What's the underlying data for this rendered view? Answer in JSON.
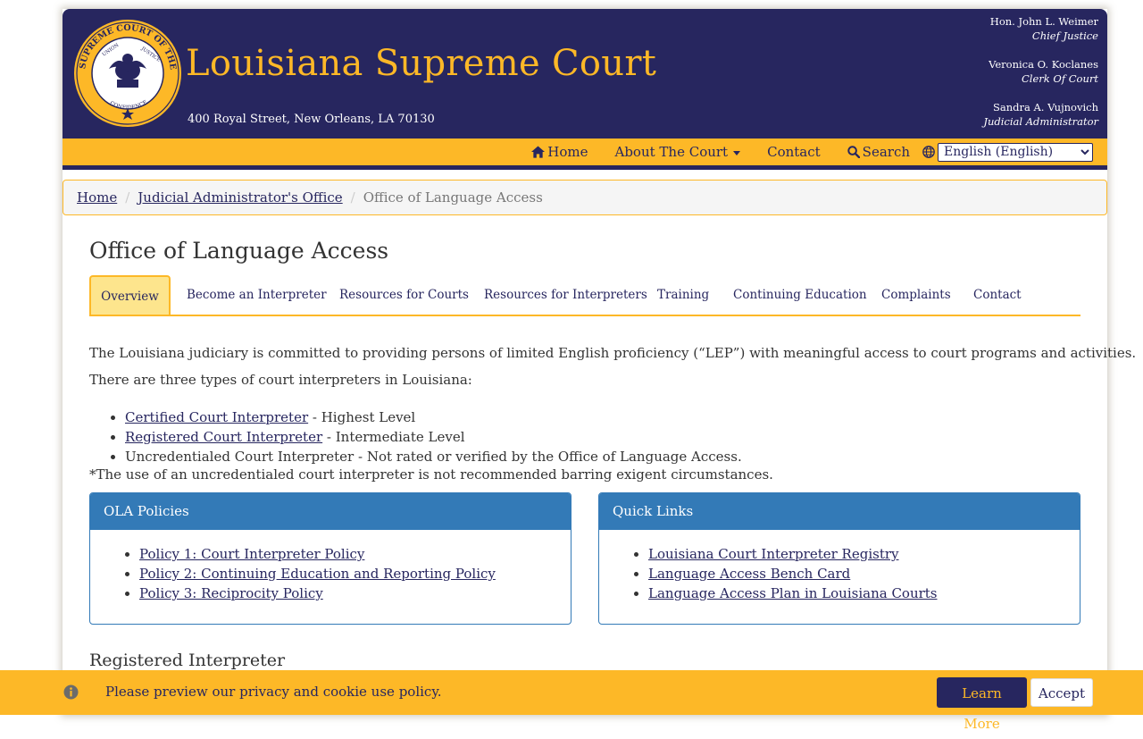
{
  "header": {
    "title": "Louisiana Supreme Court",
    "address": "400 Royal Street, New Orleans, LA 70130",
    "seal": {
      "text_top": "SUPREME COURT OF THE STATE OF LOUISIANA",
      "union": "UNION",
      "justice": "JUSTICE",
      "confidence": "CONFIDENCE"
    },
    "officials": [
      {
        "name": "Hon. John L. Weimer",
        "role": "Chief Justice"
      },
      {
        "name": "Veronica O. Koclanes",
        "role": "Clerk Of Court"
      },
      {
        "name": "Sandra A. Vujnovich",
        "role": "Judicial Administrator"
      }
    ]
  },
  "nav": {
    "home": "Home",
    "about": "About The Court",
    "contact": "Contact",
    "search": "Search",
    "language_selected": "English (English)"
  },
  "breadcrumb": {
    "home": "Home",
    "parent": "Judicial Administrator's Office",
    "current": "Office of Language Access"
  },
  "page": {
    "title": "Office of Language Access",
    "tabs": [
      {
        "label": "Overview",
        "active": true
      },
      {
        "label": "Become an Interpreter"
      },
      {
        "label": "Resources for Courts"
      },
      {
        "label": "Resources for Interpreters"
      },
      {
        "label": "Training"
      },
      {
        "label": "Continuing Education"
      },
      {
        "label": "Complaints"
      },
      {
        "label": "Contact"
      }
    ],
    "intro": "The Louisiana judiciary is committed to providing persons of limited English proficiency (“LEP”) with meaningful access to court programs and activities.",
    "types_intro": "There are three types of court interpreters in Louisiana:",
    "types": [
      {
        "link": "Certified Court Interpreter",
        "desc": " - Highest Level"
      },
      {
        "link": "Registered Court Interpreter",
        "desc": " - Intermediate Level"
      },
      {
        "text": "Uncredentialed Court Interpreter - Not rated or verified by the Office of Language Access."
      }
    ],
    "note": "*The use of an uncredentialed court interpreter is not recommended barring exigent circumstances.",
    "policies_panel": {
      "title": "OLA Policies",
      "links": [
        "Policy 1: Court Interpreter Policy",
        "Policy 2: Continuing Education and Reporting Policy",
        "Policy 3: Reciprocity Policy "
      ]
    },
    "quick_links_panel": {
      "title": "Quick Links",
      "links": [
        "Louisiana Court Interpreter Registry",
        "Language Access Bench Card",
        "Language Access Plan in Louisiana Courts"
      ]
    },
    "section_heading": "Registered Interpreter"
  },
  "cookie_banner": {
    "text": "Please preview our privacy and cookie use policy.",
    "learn_more": "Learn More",
    "accept": "Accept"
  },
  "colors": {
    "navy": "#27265f",
    "gold": "#fdb827",
    "panel_blue": "#337ab7",
    "active_tab": "#fde58d"
  },
  "icons": [
    "seal-logo",
    "home-icon",
    "caret-down-icon",
    "search-icon",
    "globe-icon",
    "info-icon"
  ]
}
